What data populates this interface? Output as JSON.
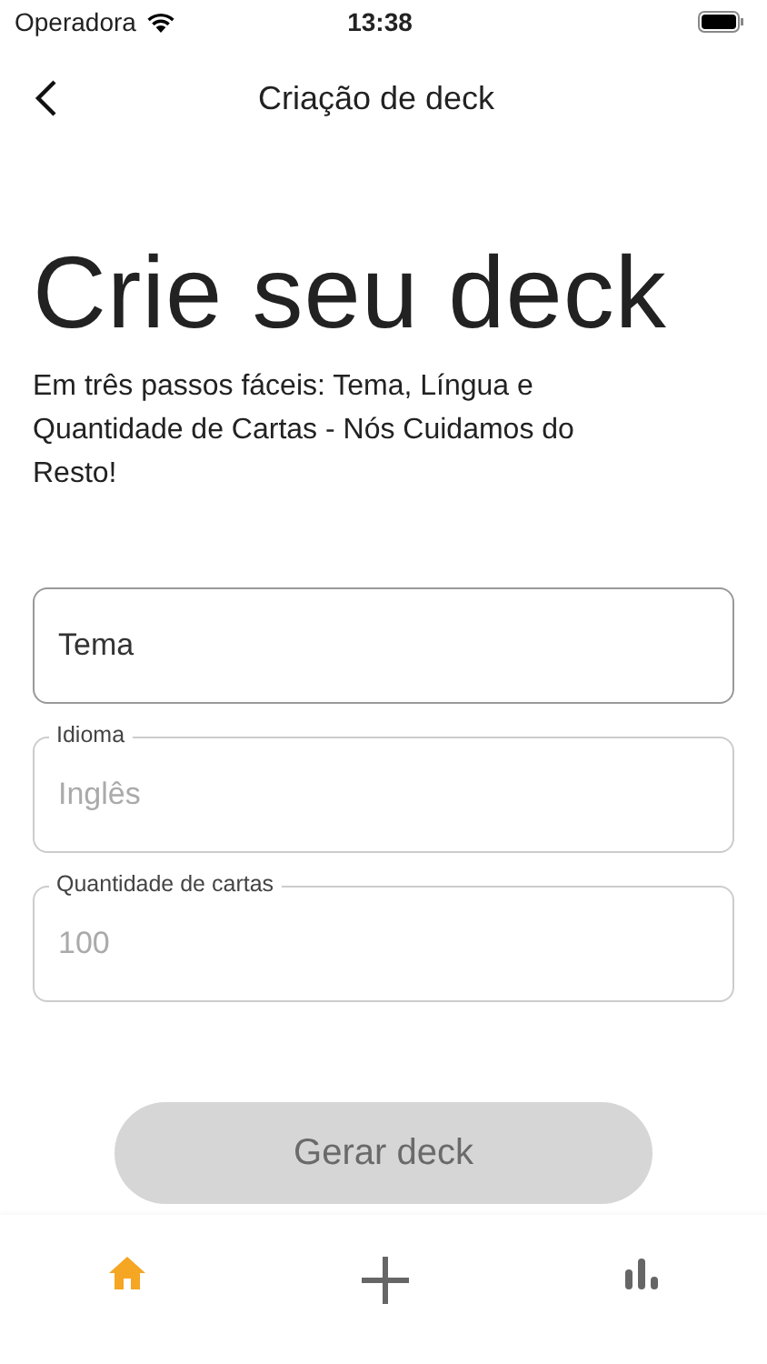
{
  "status_bar": {
    "carrier": "Operadora",
    "time": "13:38"
  },
  "nav": {
    "title": "Criação de deck"
  },
  "heading": "Crie seu deck",
  "subtitle": "Em três passos fáceis: Tema, Língua e Quantidade de Cartas - Nós Cuidamos do Resto!",
  "fields": [
    {
      "placeholder": "Tema",
      "disabled": false
    },
    {
      "label": "Idioma",
      "value": "Inglês",
      "disabled": true
    },
    {
      "label": "Quantidade de cartas",
      "value": "100",
      "disabled": true
    }
  ],
  "button": {
    "label": "Gerar deck",
    "disabled": true
  },
  "tabs": [
    {
      "kind": "home",
      "selected": true
    },
    {
      "kind": "add",
      "selected": false
    },
    {
      "kind": "stats",
      "selected": false
    }
  ]
}
